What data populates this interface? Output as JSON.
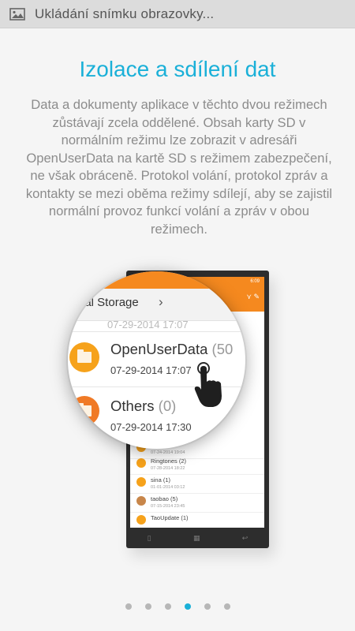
{
  "status_bar": {
    "icon": "image-icon",
    "text": "Ukládání snímku obrazovky..."
  },
  "page": {
    "title": "Izolace a sdílení dat",
    "description": "Data a dokumenty aplikace v těchto dvou režimech zůstávají zcela oddělené. Obsah karty SD v normálním režimu lze zobrazit v adresáři OpenUserData na kartě SD s režimem zabezpečení, ne však obráceně. Protokol volání, protokol zpráv a kontakty se mezi oběma režimy sdílejí, aby se zajistil normální provoz funkcí volání a zpráv v obou režimech."
  },
  "phone": {
    "time": "6:09",
    "files": [
      {
        "name": "",
        "date": "07-24-2014 19:04"
      },
      {
        "name": "Ringtones (2)",
        "date": "07-28-2014 18:22"
      },
      {
        "name": "sina (1)",
        "date": "01-01-2014 03:12"
      },
      {
        "name": "taobao (5)",
        "date": "07-15-2014 23:45"
      },
      {
        "name": "TaoUpdate (1)",
        "date": ""
      }
    ]
  },
  "magnifier": {
    "path": "rnal Storage",
    "ghost_date": "07-29-2014 17:07",
    "folders": [
      {
        "name": "OpenUserData",
        "count": "(50",
        "date": "07-29-2014 17:07"
      },
      {
        "name": "Others",
        "count": "(0)",
        "date": "07-29-2014 17:30"
      }
    ]
  },
  "pagination": {
    "total": 6,
    "active_index": 3,
    "active_color": "#1ab0d8",
    "inactive_color": "#b7b7b7"
  },
  "colors": {
    "title": "#1ab0d8",
    "accent": "#f5891f"
  }
}
